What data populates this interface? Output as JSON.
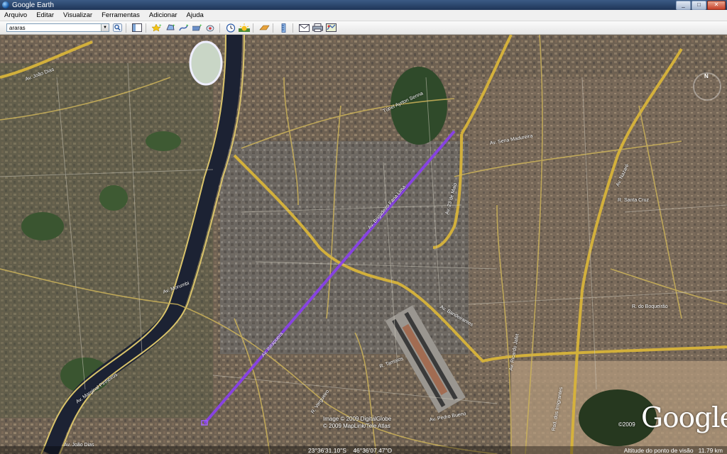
{
  "window": {
    "title": "Google Earth",
    "btn_min": "_",
    "btn_max": "□",
    "btn_close": "✕"
  },
  "menu": [
    "Arquivo",
    "Editar",
    "Visualizar",
    "Ferramentas",
    "Adicionar",
    "Ajuda"
  ],
  "search": {
    "value": "araras"
  },
  "toolbar_icons": [
    "sidebar-icon",
    "placemark-icon",
    "polygon-icon",
    "path-icon",
    "image-overlay-icon",
    "record-tour-icon",
    "historical-imagery-icon",
    "sunlight-icon",
    "switch-to-sky-icon",
    "ruler-icon",
    "email-icon",
    "print-icon",
    "view-in-maps-icon"
  ],
  "map": {
    "imagery_copyright": "Image © 2009 DigitalGlobe",
    "data_copyright": "© 2009 MapLink/Tele Atlas",
    "logo_year": "©2009",
    "logo": "Google",
    "coordinates": "23°36'31.10\"S    46°36'07.47\"O",
    "altitude": "Altitude do ponto de visão   11.79 km",
    "compass_north": "N",
    "road_labels": [
      "Av. Marginal Pinheiros",
      "Av. Ibirapuera",
      "Av. Bandeirantes",
      "Av. 23 de Maio",
      "Av. Washington Luís",
      "R. Tamoios",
      "Av. Rubem Berta",
      "Av. dos Bandeirantes",
      "Av. Pedro Bueno",
      "Av. Interlagos",
      "Av. Vereador José Diniz",
      "Av. Santo Amaro",
      "Av. Jornalista Roberto Marinho",
      "Rod. dos Imigrantes",
      "Av. Ricardo Jafet",
      "Av. Abraão de Morais",
      "Av. Domingos de Morais",
      "Av. Nazaré",
      "Av. Tancredo Neves",
      "R. Santa Cruz",
      "Av. Sena Madureira",
      "Túnel Ayrton Senna",
      "Av. República do Líbano",
      "Av. Morumbi",
      "Av. Brigadeiro Faria Lima",
      "R. Vergueiro",
      "R. do Boqueirão",
      "Av. Fagundes Filho",
      "R. Vergueiro",
      "Al. Jauaperi",
      "R. Joel Carlos Borges",
      "Av. João Dias"
    ]
  }
}
